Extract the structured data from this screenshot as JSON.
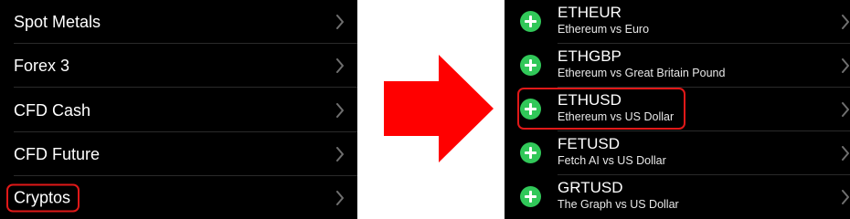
{
  "left_list": {
    "items": [
      {
        "label": "Spot Metals"
      },
      {
        "label": "Forex 3"
      },
      {
        "label": "CFD Cash"
      },
      {
        "label": "CFD Future"
      },
      {
        "label": "Cryptos",
        "highlighted": true
      }
    ]
  },
  "right_list": {
    "items": [
      {
        "symbol": "ETHEUR",
        "description": "Ethereum vs Euro"
      },
      {
        "symbol": "ETHGBP",
        "description": "Ethereum vs Great Britain Pound"
      },
      {
        "symbol": "ETHUSD",
        "description": "Ethereum vs US Dollar",
        "highlighted": true
      },
      {
        "symbol": "FETUSD",
        "description": "Fetch AI vs US Dollar"
      },
      {
        "symbol": "GRTUSD",
        "description": "The Graph vs US Dollar"
      }
    ]
  },
  "icons": {
    "chevron": "chevron-right-icon",
    "add": "plus-circle-icon",
    "arrow": "arrow-right-icon"
  },
  "colors": {
    "background": "#000000",
    "highlight": "#e01818",
    "add_button": "#31c859",
    "arrow": "#ff0000"
  }
}
